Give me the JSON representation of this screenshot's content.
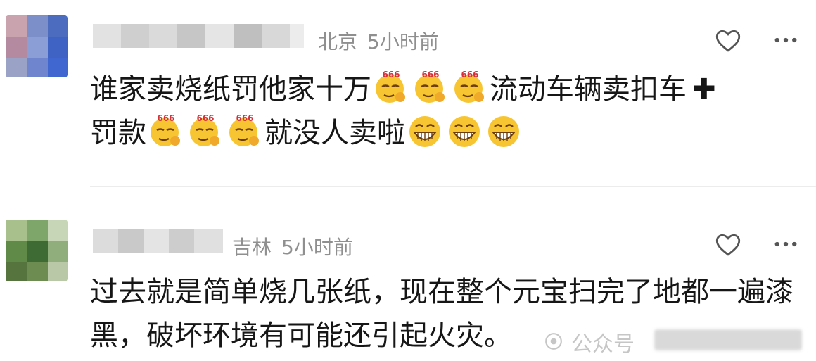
{
  "comments": [
    {
      "location": "北京",
      "time": "5小时前",
      "text_parts": {
        "a": "谁家卖烧纸罚他家十万",
        "b": "流动车辆卖扣车",
        "plus": "✚",
        "c": "罚款",
        "d": "就没人卖啦"
      },
      "emoji_groups": [
        "666-emoji",
        "666-emoji",
        "grin-emoji"
      ]
    },
    {
      "location": "吉林",
      "time": "5小时前",
      "text": "过去就是简单烧几张纸，现在整个元宝扫完了地都一遍漆黑，破坏环境有可能还引起火灾。"
    }
  ],
  "icons": {
    "like": "heart-outline-icon",
    "more": "more-dots-icon",
    "watermark": "wechat-official-account-icon"
  },
  "watermark": {
    "text": "公众号"
  },
  "colors": {
    "text": "#161616",
    "meta": "#8f8f8f",
    "divider": "#ececec",
    "icon": "#555555",
    "emoji_face": "#f7c531",
    "emoji_666": "#d6303a"
  }
}
